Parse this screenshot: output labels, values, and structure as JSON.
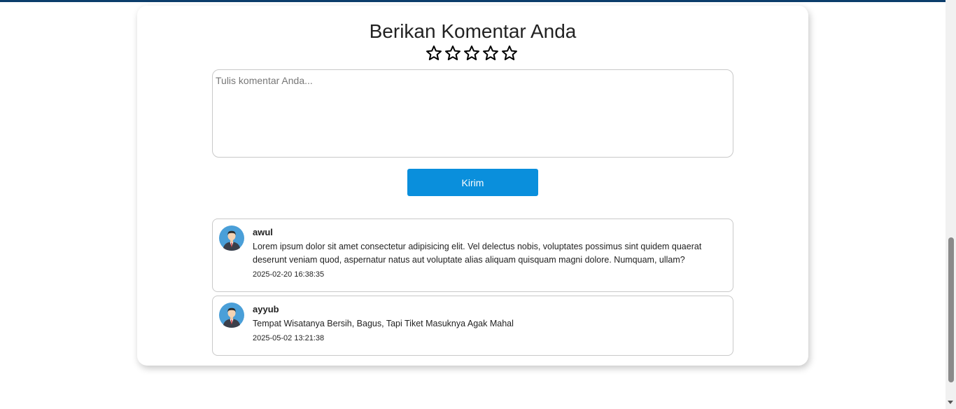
{
  "form": {
    "title": "Berikan Komentar Anda",
    "rating": {
      "max_stars": 5,
      "selected": 0
    },
    "placeholder": "Tulis komentar Anda...",
    "submit_label": "Kirim"
  },
  "comments": [
    {
      "name": "awul",
      "text": "Lorem ipsum dolor sit amet consectetur adipisicing elit. Vel delectus nobis, voluptates possimus sint quidem quaerat deserunt veniam quod, aspernatur natus aut voluptate alias aliquam quisquam magni dolore. Numquam, ullam?",
      "date": "2025-02-20 16:38:35"
    },
    {
      "name": "ayyub",
      "text": "Tempat Wisatanya Bersih, Bagus, Tapi Tiket Masuknya Agak Mahal",
      "date": "2025-05-02 13:21:38"
    }
  ],
  "colors": {
    "accent": "#0a8fdc",
    "top_bar": "#0b3d6b",
    "avatar_bg": "#4a9fd8"
  }
}
